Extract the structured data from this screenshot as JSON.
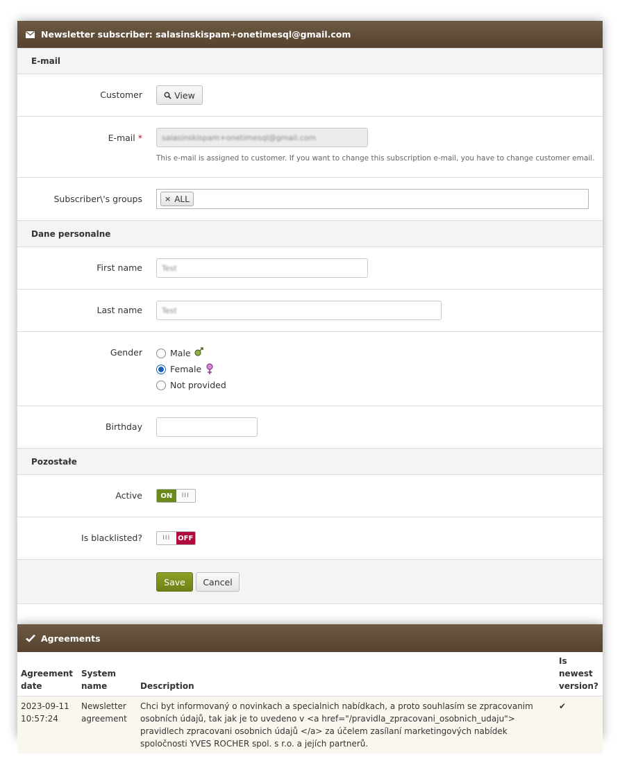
{
  "header": {
    "icon": "envelope-icon",
    "title": "Newsletter subscriber: salasinskispam+onetimesql@gmail.com"
  },
  "sections": {
    "email": "E-mail",
    "personal": "Dane personalne",
    "other": "Pozostałe"
  },
  "customer": {
    "label": "Customer",
    "view_button": "View"
  },
  "email_field": {
    "label": "E-mail",
    "required_mark": "*",
    "value": "salasinskispam+onetimesql@gmail.com",
    "help": "This e-mail is assigned to customer. If you want to change this subscription e-mail, you have to change customer email."
  },
  "groups": {
    "label": "Subscriber\\'s groups",
    "tags": [
      "ALL"
    ],
    "remove_glyph": "×"
  },
  "first_name": {
    "label": "First name",
    "value": "Test"
  },
  "last_name": {
    "label": "Last name",
    "value": "Test"
  },
  "gender": {
    "label": "Gender",
    "options": [
      "Male",
      "Female",
      "Not provided"
    ],
    "selected": "Female"
  },
  "birthday": {
    "label": "Birthday",
    "value": ""
  },
  "active": {
    "label": "Active",
    "on_text": "ON",
    "grip": "III",
    "state": true
  },
  "blacklisted": {
    "label": "Is blacklisted?",
    "off_text": "OFF",
    "grip": "III",
    "state": false
  },
  "actions": {
    "save": "Save",
    "cancel": "Cancel"
  },
  "agreements": {
    "title": "Agreements",
    "icon": "check-icon",
    "columns": [
      "Agreement date",
      "System name",
      "Description",
      "Is newest version?"
    ],
    "rows": [
      {
        "date": "2023-09-11 10:57:24",
        "system_name": "Newsletter agreement",
        "description": "Chci byt informovaný o novinkach a specialnich nabídkach, a proto souhlasím se zpracovanim osobních údajů, tak jak je to uvedeno v <a href=\"/pravidla_zpracovani_osobnich_udaju\"> pravidlech zpracovani osobnich údajů </a> za účelem zasílaní marketingových nabídek spoločnosti YVES ROCHER spol. s r.o. a jejích partnerů.",
        "newest": "✔"
      }
    ]
  },
  "colors": {
    "header_bg": "#5f4c38",
    "save_green": "#7d8e1e",
    "on_green": "#6c8a1a",
    "off_red": "#b0093b",
    "radio_blue": "#1a5fb4"
  }
}
